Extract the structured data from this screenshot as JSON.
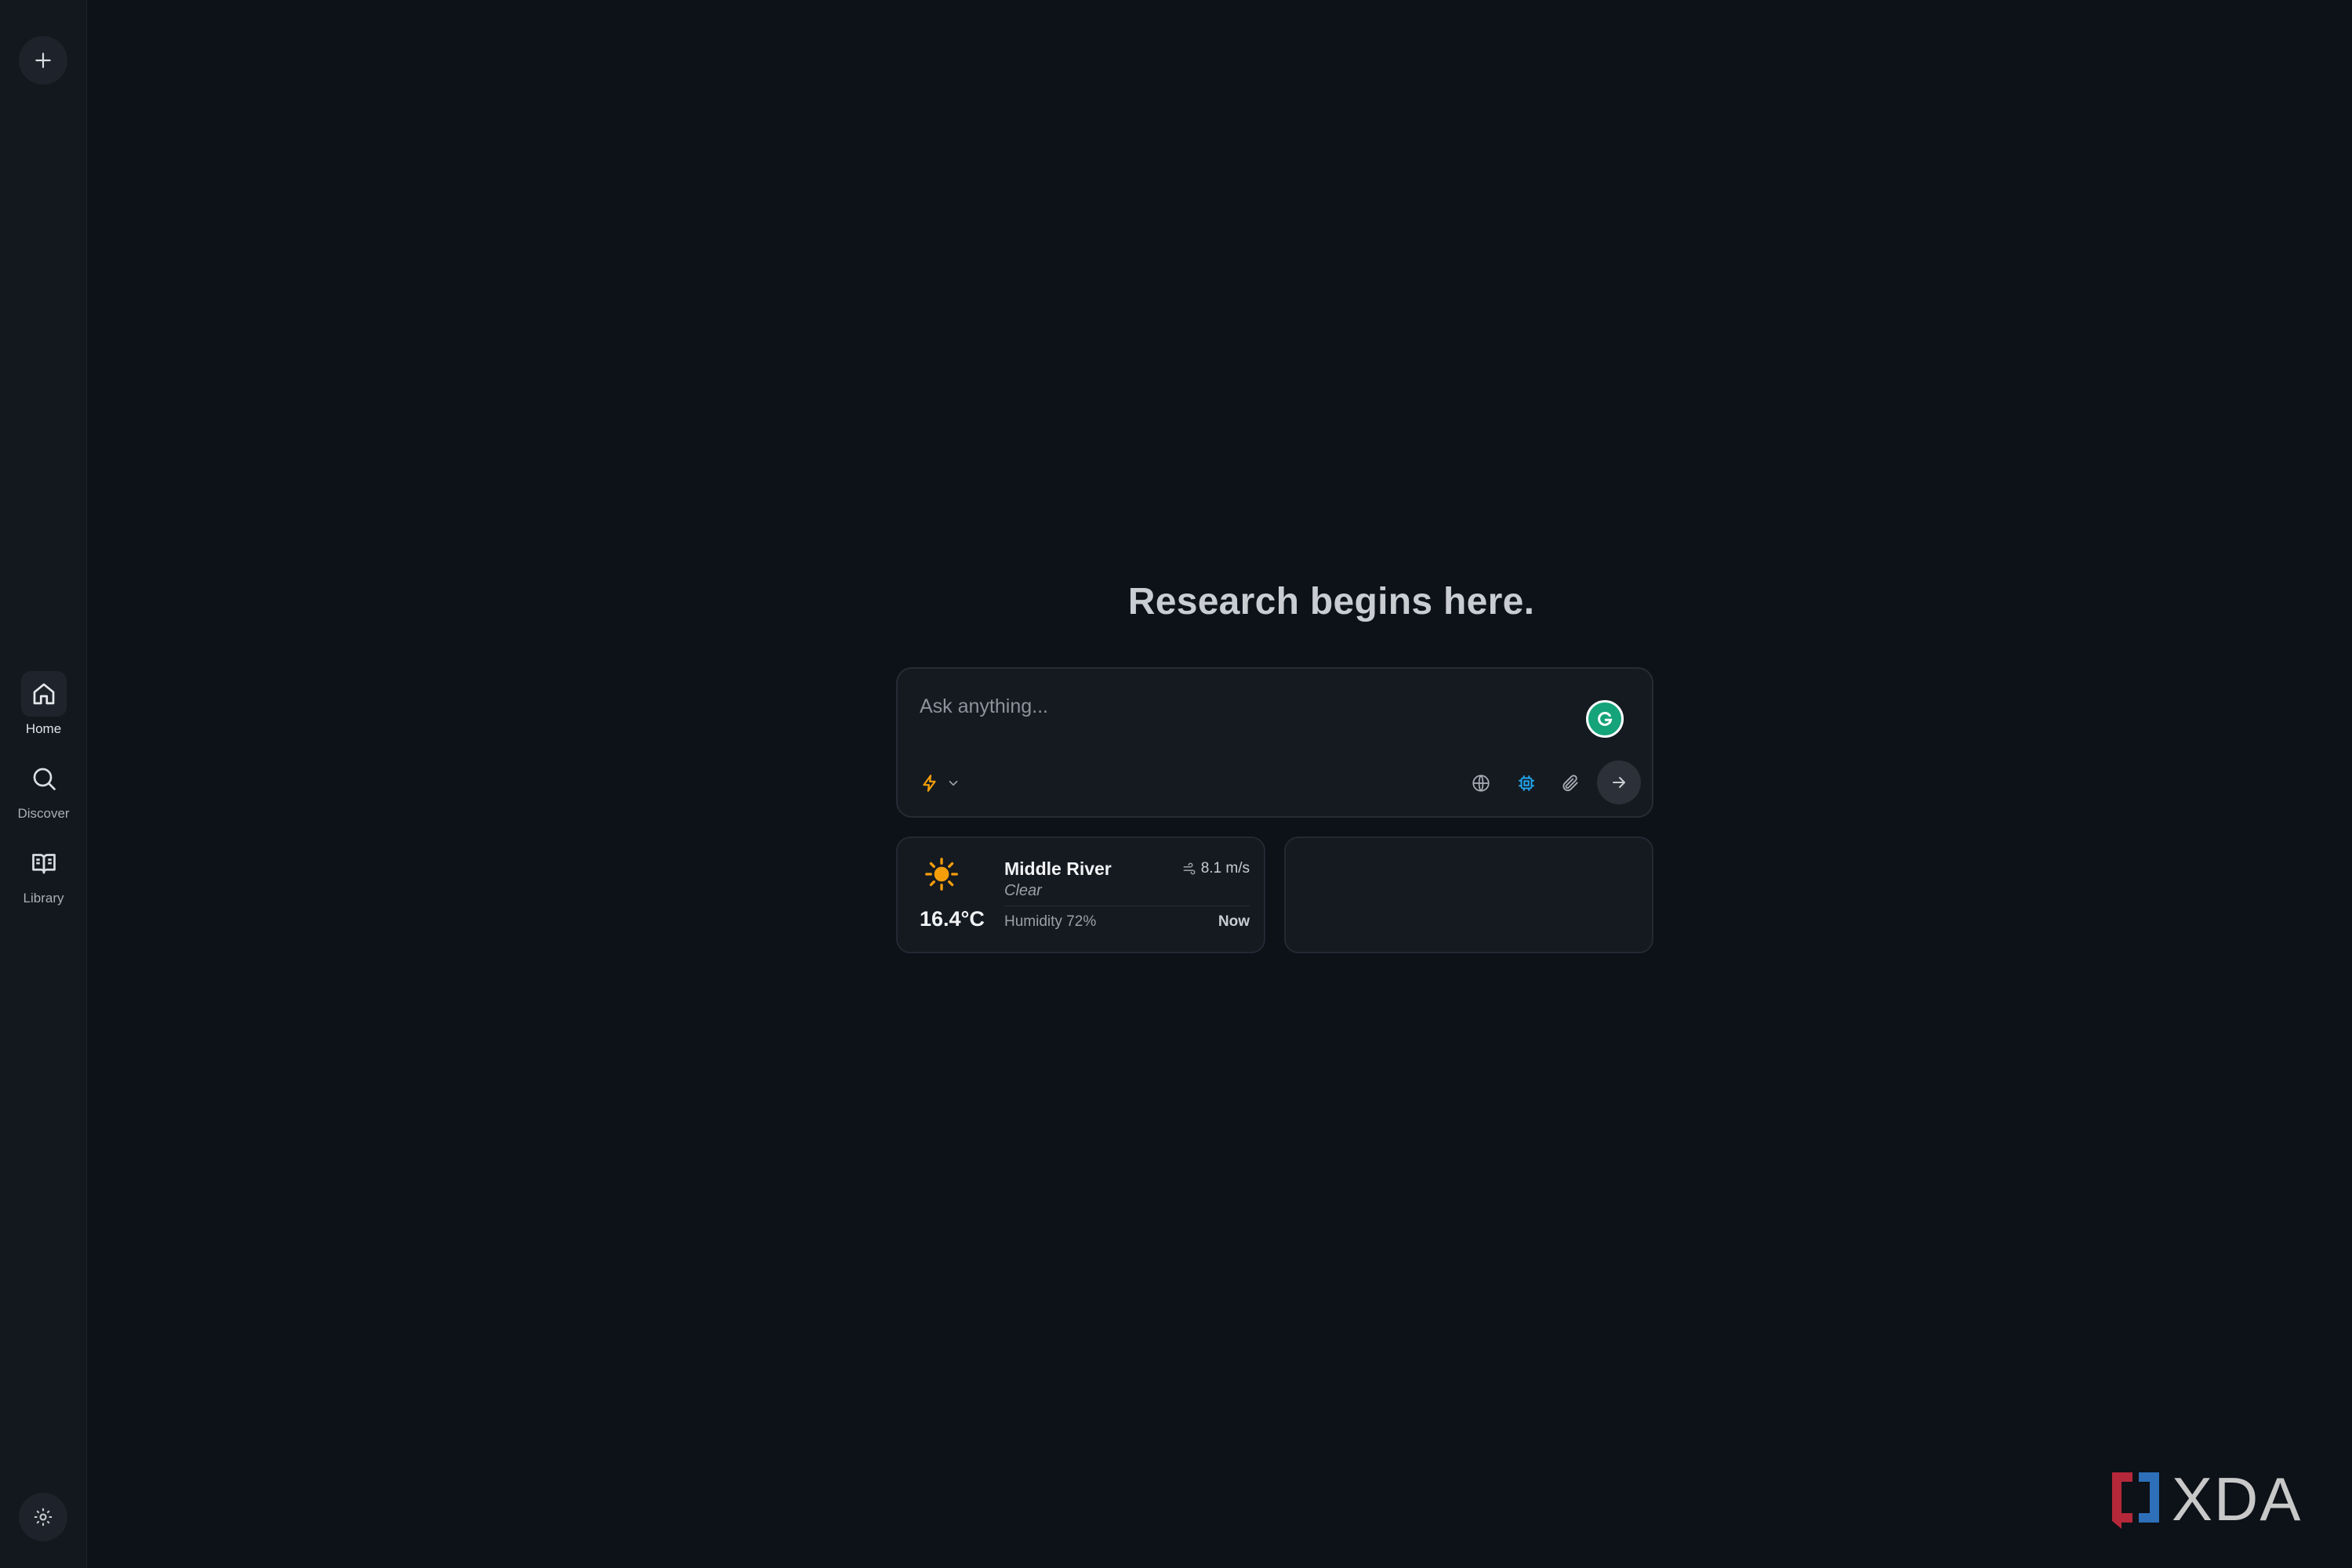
{
  "sidebar": {
    "new_chat_icon": "plus-icon",
    "items": [
      {
        "label": "Home",
        "icon": "home-icon",
        "active": true
      },
      {
        "label": "Discover",
        "icon": "search-icon",
        "active": false
      },
      {
        "label": "Library",
        "icon": "book-open-icon",
        "active": false
      }
    ],
    "settings_icon": "gear-icon"
  },
  "main": {
    "headline": "Research begins here.",
    "search": {
      "placeholder": "Ask anything...",
      "value": ""
    },
    "tools": {
      "mode_icon": "lightning-icon",
      "accent_color": "#f59e0b",
      "active_tool_color": "#22a7f0",
      "buttons": [
        "globe-icon",
        "chip-icon",
        "paperclip-icon"
      ],
      "send_icon": "arrow-right-icon"
    }
  },
  "weather": {
    "temp": "16.4°C",
    "location": "Middle River",
    "condition": "Clear",
    "wind": "8.1 m/s",
    "humidity": "Humidity 72%",
    "time": "Now",
    "icon": "sun-icon"
  },
  "watermark": {
    "brand": "XDA"
  }
}
